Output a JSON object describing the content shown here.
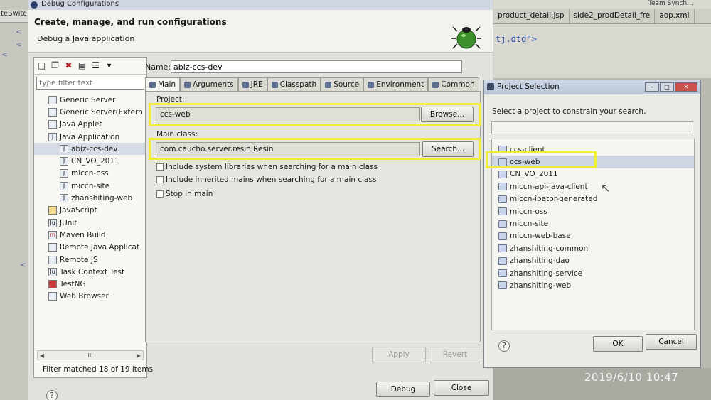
{
  "background": {
    "left_tab": "teSwitc",
    "editor_tabs": [
      "product_detail.jsp",
      "side2_prodDetail_fre",
      "aop.xml"
    ],
    "editor_code": "tj.dtd\">",
    "team_sync": "Team Synch..."
  },
  "dialog": {
    "title": "Debug Configurations",
    "heading": "Create, manage, and run configurations",
    "subheading": "Debug a Java application",
    "filter_placeholder": "type filter text",
    "tree": [
      {
        "label": "Generic Server",
        "level": 1
      },
      {
        "label": "Generic Server(Extern",
        "level": 1
      },
      {
        "label": "Java Applet",
        "level": 1
      },
      {
        "label": "Java Application",
        "level": 1
      },
      {
        "label": "abiz-ccs-dev",
        "level": 2,
        "selected": true
      },
      {
        "label": "CN_VO_2011",
        "level": 2
      },
      {
        "label": "miccn-oss",
        "level": 2
      },
      {
        "label": "miccn-site",
        "level": 2
      },
      {
        "label": "zhanshiting-web",
        "level": 2
      },
      {
        "label": "JavaScript",
        "level": 1
      },
      {
        "label": "JUnit",
        "level": 1
      },
      {
        "label": "Maven Build",
        "level": 1
      },
      {
        "label": "Remote Java Applicat",
        "level": 1
      },
      {
        "label": "Remote JS",
        "level": 1
      },
      {
        "label": "Task Context Test",
        "level": 1
      },
      {
        "label": "TestNG",
        "level": 1
      },
      {
        "label": "Web Browser",
        "level": 1
      }
    ],
    "filter_status": "Filter matched 18 of 19 items",
    "name_label": "Name:",
    "name_value": "abiz-ccs-dev",
    "tabs": [
      "Main",
      "Arguments",
      "JRE",
      "Classpath",
      "Source",
      "Environment",
      "Common"
    ],
    "project_label": "Project:",
    "project_value": "ccs-web",
    "browse_label": "Browse...",
    "main_class_label": "Main class:",
    "main_class_value": "com.caucho.server.resin.Resin",
    "search_label": "Search...",
    "checkboxes": [
      "Include system libraries when searching for a main class",
      "Include inherited mains when searching for a main class",
      "Stop in main"
    ],
    "apply_label": "Apply",
    "revert_label": "Revert",
    "debug_label": "Debug",
    "close_label": "Close",
    "highlight_color": "#f1ec3a"
  },
  "project_selection": {
    "title": "Project Selection",
    "prompt": "Select a project to constrain your search.",
    "projects": [
      "ccs-client",
      "ccs-web",
      "CN_VO_2011",
      "miccn-api-java-client",
      "miccn-ibator-generated",
      "miccn-oss",
      "miccn-site",
      "miccn-web-base",
      "zhanshiting-common",
      "zhanshiting-dao",
      "zhanshiting-service",
      "zhanshiting-web"
    ],
    "selected": "ccs-web",
    "ok_label": "OK",
    "cancel_label": "Cancel"
  },
  "timestamp": "2019/6/10  10:47"
}
